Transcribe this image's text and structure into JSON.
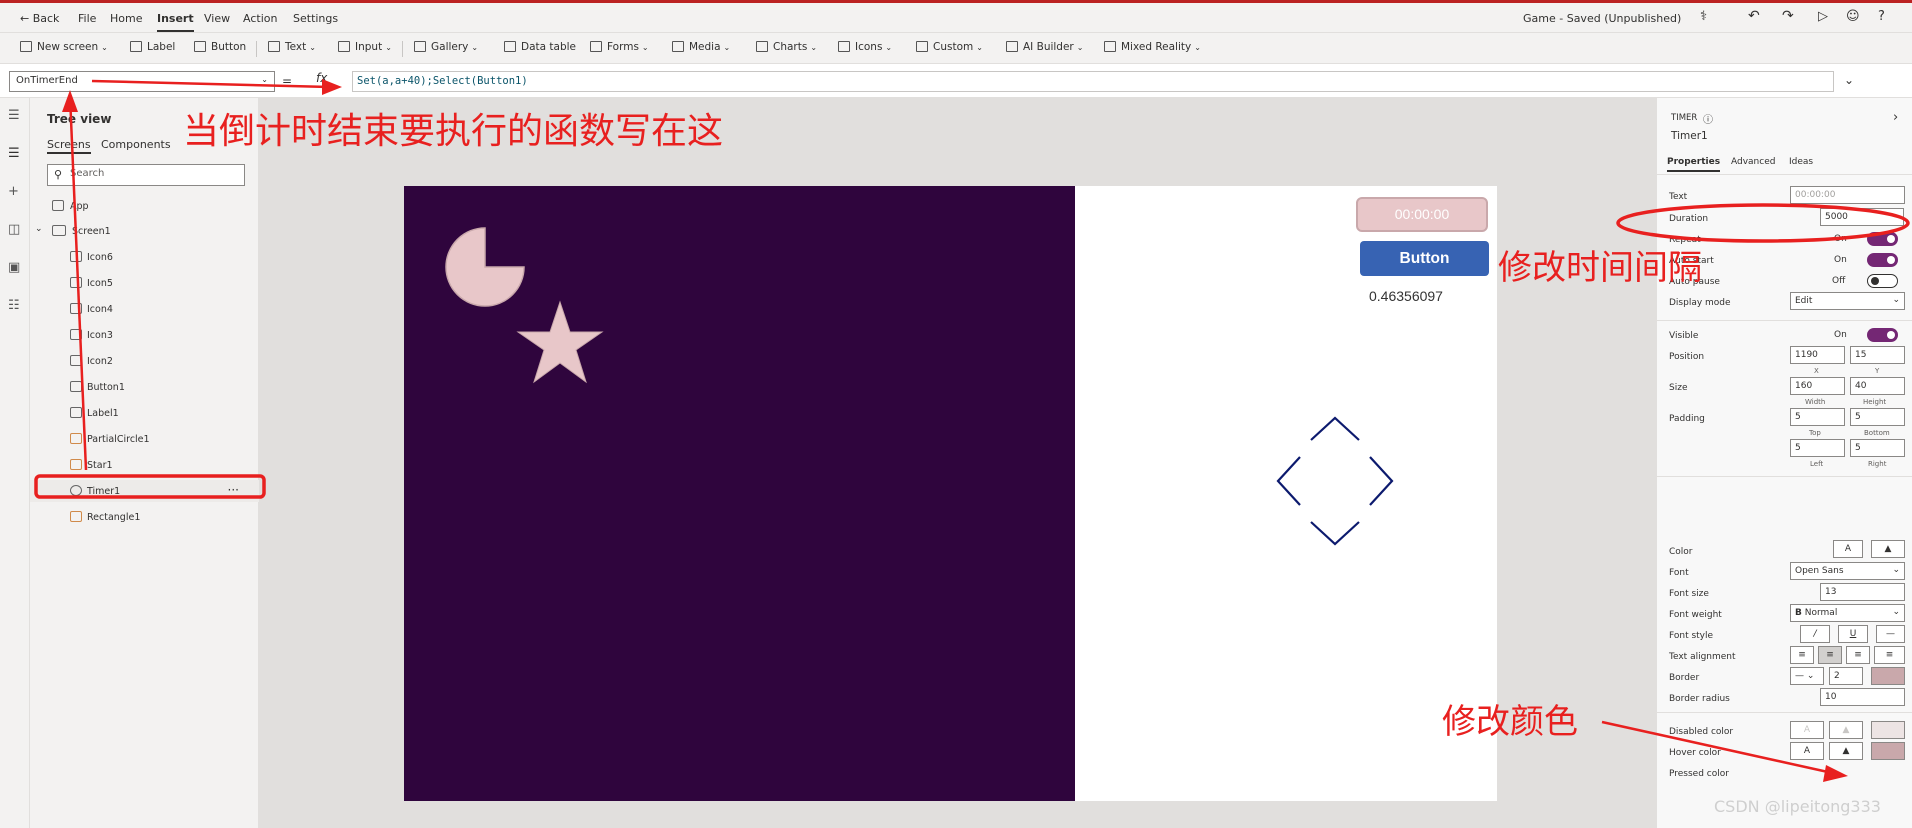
{
  "menubar": {
    "back": "Back",
    "file": "File",
    "home": "Home",
    "insert": "Insert",
    "view": "View",
    "action": "Action",
    "settings": "Settings",
    "app_title": "Game - Saved (Unpublished)"
  },
  "ribbon": {
    "new_screen": "New screen",
    "label": "Label",
    "button": "Button",
    "text": "Text",
    "input": "Input",
    "gallery": "Gallery",
    "data_table": "Data table",
    "forms": "Forms",
    "media": "Media",
    "charts": "Charts",
    "icons": "Icons",
    "custom": "Custom",
    "ai_builder": "AI Builder",
    "mixed_reality": "Mixed Reality"
  },
  "formula_bar": {
    "property": "OnTimerEnd",
    "equals": "=",
    "fx": "fx",
    "formula": "Set(a,a+40);Select(Button1)"
  },
  "tree_view": {
    "title": "Tree view",
    "tab_screens": "Screens",
    "tab_components": "Components",
    "search_placeholder": "Search",
    "items": [
      {
        "label": "App"
      },
      {
        "label": "Screen1"
      },
      {
        "label": "Icon6"
      },
      {
        "label": "Icon5"
      },
      {
        "label": "Icon4"
      },
      {
        "label": "Icon3"
      },
      {
        "label": "Icon2"
      },
      {
        "label": "Button1"
      },
      {
        "label": "Label1"
      },
      {
        "label": "PartialCircle1"
      },
      {
        "label": "Star1"
      },
      {
        "label": "Timer1"
      },
      {
        "label": "Rectangle1"
      }
    ]
  },
  "canvas": {
    "timer_text": "00:00:00",
    "button_text": "Button",
    "label_text": "0.46356097",
    "rect_color": "#2f053d",
    "shape_color": "#e8c7c9",
    "button_color": "#3763b3",
    "icon_color": "#0c1a6e"
  },
  "properties": {
    "control_type": "TIMER",
    "control_name": "Timer1",
    "tab_properties": "Properties",
    "tab_advanced": "Advanced",
    "tab_ideas": "Ideas",
    "text_label": "Text",
    "text_value": "00:00:00",
    "duration_label": "Duration",
    "duration_value": "5000",
    "repeat_label": "Repeat",
    "repeat_value": "On",
    "autostart_label": "Auto start",
    "autostart_value": "On",
    "autopause_label": "Auto pause",
    "autopause_value": "Off",
    "displaymode_label": "Display mode",
    "displaymode_value": "Edit",
    "visible_label": "Visible",
    "visible_value": "On",
    "position_label": "Position",
    "position_x": "1190",
    "position_y": "15",
    "x_label": "X",
    "y_label": "Y",
    "size_label": "Size",
    "size_w": "160",
    "size_h": "40",
    "width_label": "Width",
    "height_label": "Height",
    "padding_label": "Padding",
    "padding_top": "5",
    "padding_bottom": "5",
    "padding_left": "5",
    "padding_right": "5",
    "top_label": "Top",
    "bottom_label": "Bottom",
    "left_label": "Left",
    "right_label": "Right",
    "color_label": "Color",
    "font_label": "Font",
    "font_value": "Open Sans",
    "fontsize_label": "Font size",
    "fontsize_value": "13",
    "fontweight_label": "Font weight",
    "fontweight_value": "Normal",
    "fontstyle_label": "Font style",
    "textalign_label": "Text alignment",
    "border_label": "Border",
    "border_value": "2",
    "borderradius_label": "Border radius",
    "borderradius_value": "10",
    "disabledcolor_label": "Disabled color",
    "hovercolor_label": "Hover color",
    "pressedcolor_label": "Pressed color"
  },
  "annotations": {
    "formula_note": "当倒计时结束要执行的函数写在这",
    "duration_note": "修改时间间隔",
    "color_note": "修改颜色",
    "watermark": "CSDN @lipeitong333"
  }
}
